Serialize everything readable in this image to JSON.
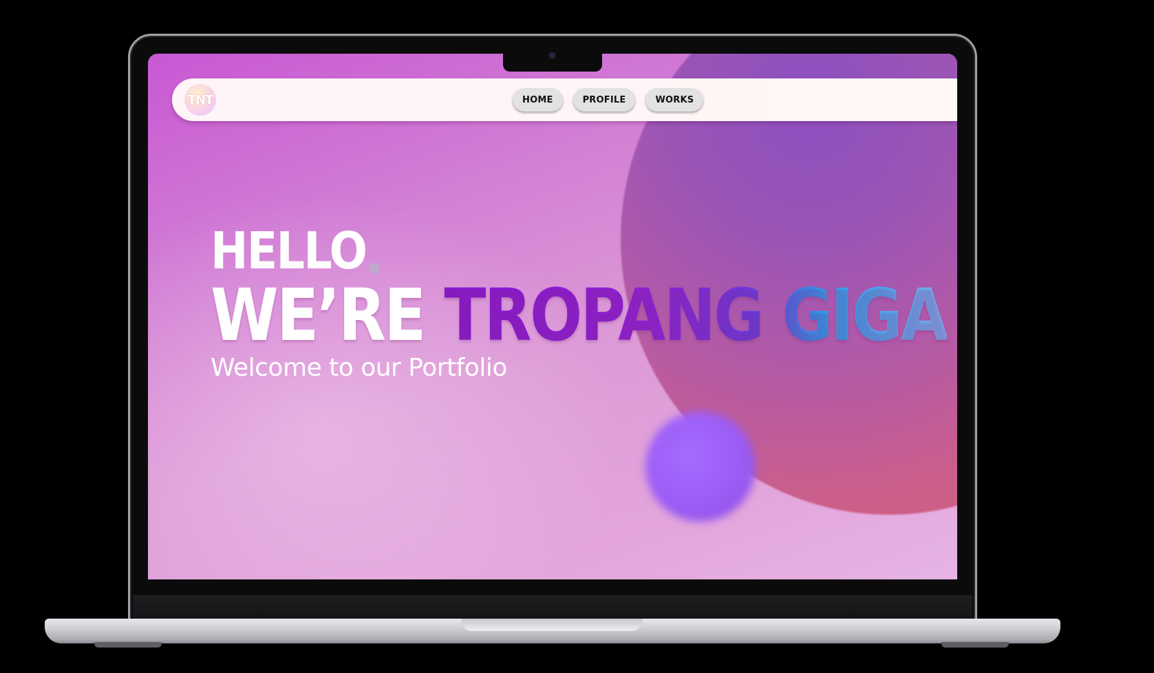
{
  "site": {
    "logo_text": "TNT",
    "nav": [
      {
        "label": "HOME"
      },
      {
        "label": "PROFILE"
      },
      {
        "label": "WORKS"
      }
    ]
  },
  "hero": {
    "greeting": "HELLO",
    "headline_prefix": "WE’RE",
    "headline_brand": "TROPANG GIGA",
    "subtitle": "Welcome to our Portfolio"
  },
  "colors": {
    "background_gradient": [
      "#c858d4",
      "#e6b3e4"
    ],
    "brand_gradient": [
      "#8a16d6",
      "#2aa3f0",
      "#7fb3f2"
    ],
    "nav_button": "#e2e2e2"
  }
}
